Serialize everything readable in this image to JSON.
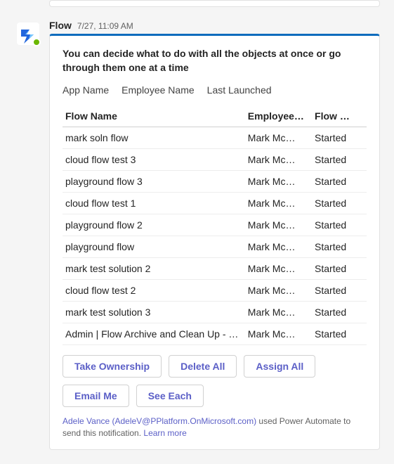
{
  "message": {
    "sender": "Flow",
    "timestamp": "7/27, 11:09 AM"
  },
  "card": {
    "title": "You can decide what to do with all the objects at once or go through them one at a time",
    "meta_labels": [
      "App Name",
      "Employee Name",
      "Last Launched"
    ],
    "columns": [
      "Flow Name",
      "Employee…",
      "Flow …"
    ],
    "rows": [
      {
        "name": "mark soln flow",
        "employee": "Mark Mc…",
        "status": "Started"
      },
      {
        "name": "cloud flow test 3",
        "employee": "Mark Mc…",
        "status": "Started"
      },
      {
        "name": "playground flow 3",
        "employee": "Mark Mc…",
        "status": "Started"
      },
      {
        "name": "cloud flow test 1",
        "employee": "Mark Mc…",
        "status": "Started"
      },
      {
        "name": "playground flow 2",
        "employee": "Mark Mc…",
        "status": "Started"
      },
      {
        "name": "playground flow",
        "employee": "Mark Mc…",
        "status": "Started"
      },
      {
        "name": "mark test solution 2",
        "employee": "Mark Mc…",
        "status": "Started"
      },
      {
        "name": "cloud flow test 2",
        "employee": "Mark Mc…",
        "status": "Started"
      },
      {
        "name": "mark test solution 3",
        "employee": "Mark Mc…",
        "status": "Started"
      },
      {
        "name": "Admin | Flow Archive and Clean Up - Chec…",
        "employee": "Mark Mc…",
        "status": "Started"
      }
    ],
    "actions": {
      "take_ownership": "Take Ownership",
      "delete_all": "Delete All",
      "assign_all": "Assign All",
      "email_me": "Email Me",
      "see_each": "See Each"
    },
    "footer": {
      "identity": "Adele Vance (AdeleV@PPlatform.OnMicrosoft.com)",
      "suffix": " used Power Automate to send this notification. ",
      "learn_more": "Learn more"
    }
  }
}
